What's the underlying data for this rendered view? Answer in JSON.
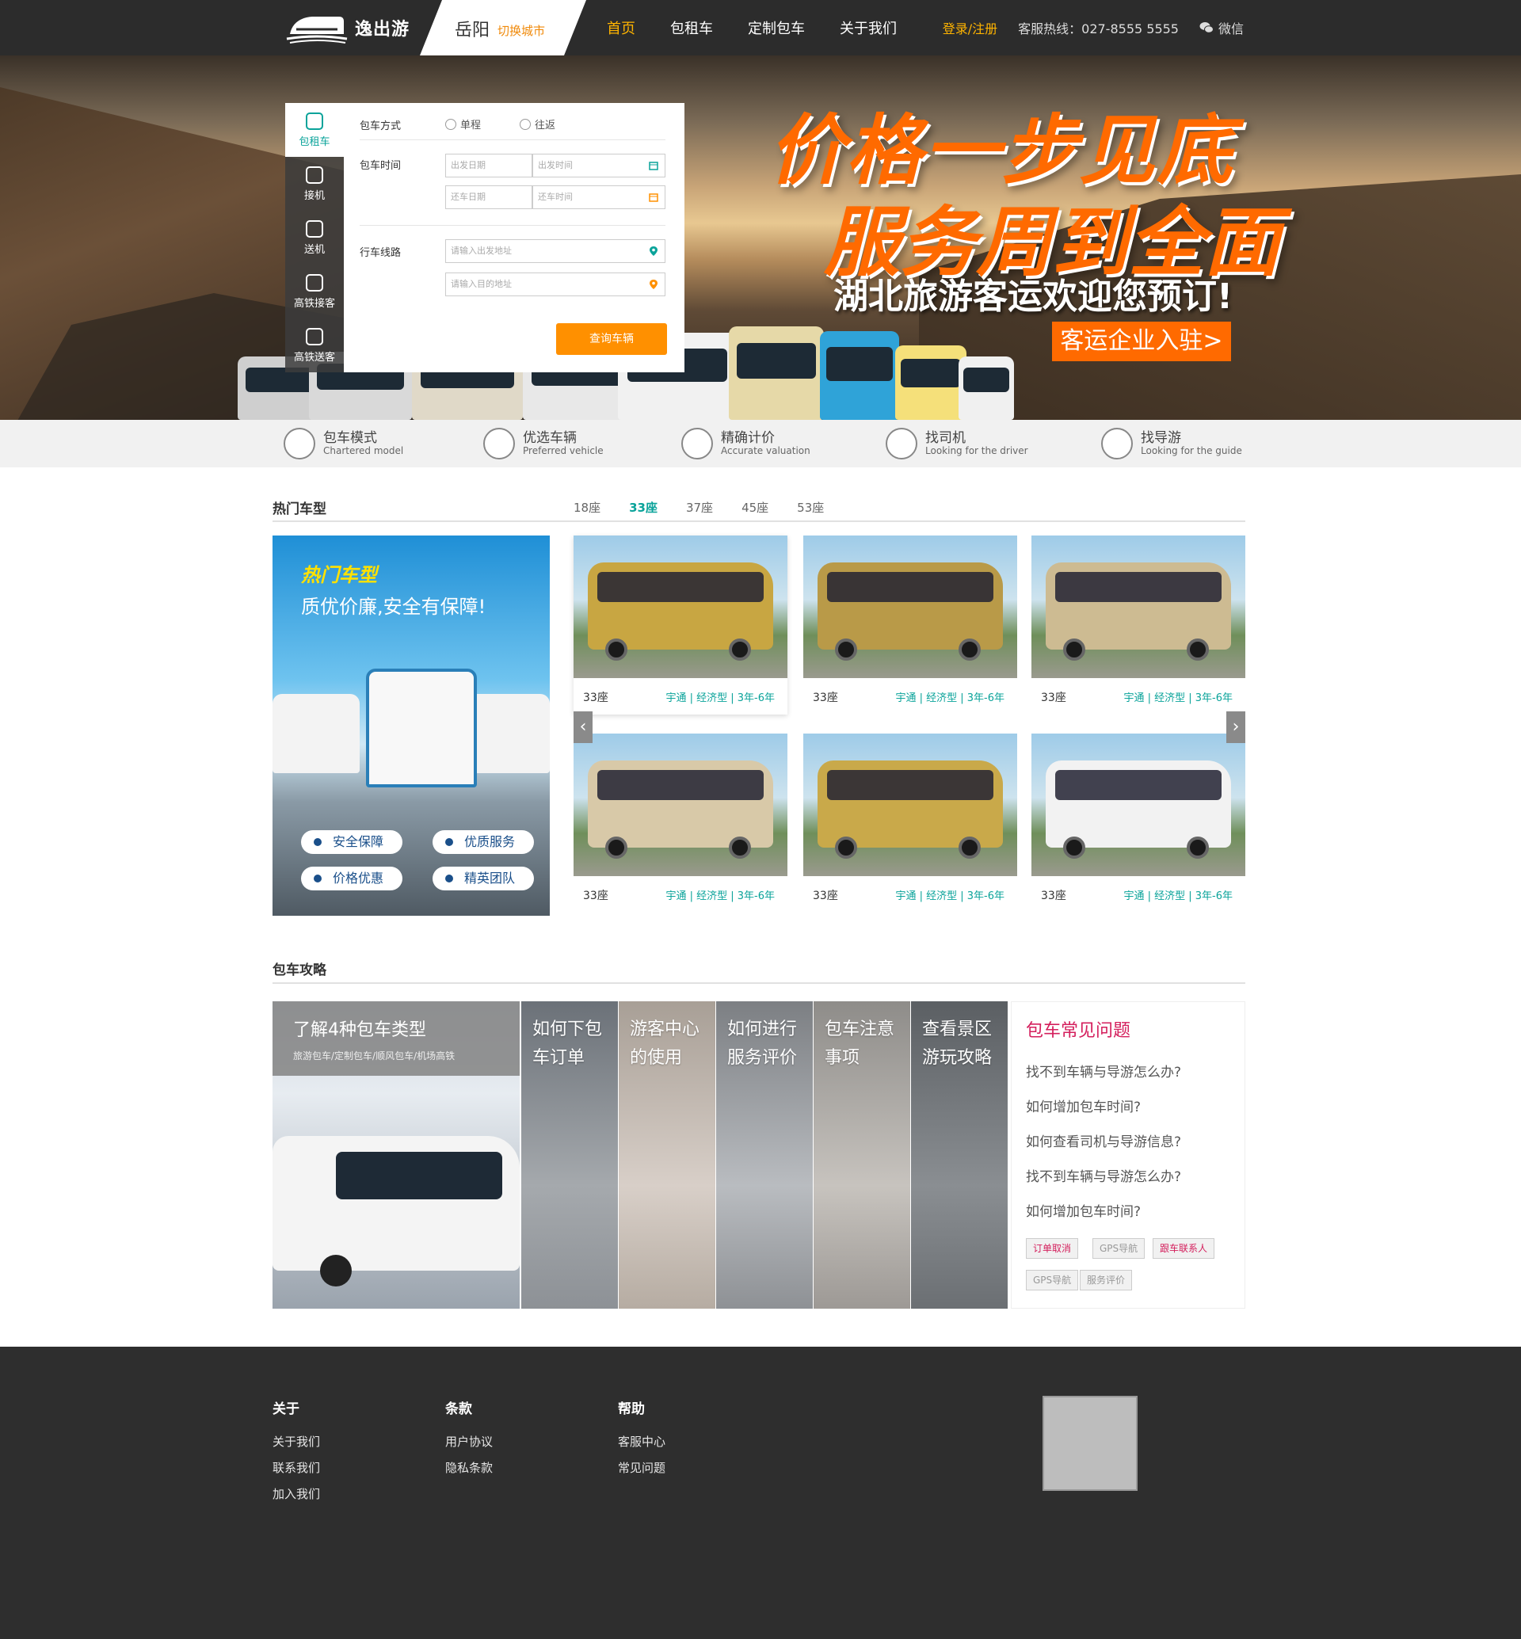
{
  "header": {
    "logo_text": "逸出游",
    "city": "岳阳",
    "city_switch": "切换城市",
    "nav": [
      "首页",
      "包租车",
      "定制包车",
      "关于我们"
    ],
    "login": "登录/注册",
    "hotline": "客服热线：027-8555 5555",
    "wechat": "微信"
  },
  "banner": {
    "slogan1": "价格一步见底",
    "slogan2": "服务周到全面",
    "slogan3": "湖北旅游客运欢迎您预订!",
    "enter_button": "客运企业入驻>"
  },
  "booking": {
    "side_tabs": [
      "包租车",
      "接机",
      "送机",
      "高铁接客",
      "高铁送客"
    ],
    "mode_label": "包车方式",
    "mode_options": [
      "单程",
      "往返"
    ],
    "time_label": "包车时间",
    "depart_date": "出发日期",
    "depart_time": "出发时间",
    "return_date": "还车日期",
    "return_time": "还车时间",
    "route_label": "行车线路",
    "from_placeholder": "请输入出发地址",
    "to_placeholder": "请输入目的地址",
    "query_button": "查询车辆"
  },
  "features": [
    {
      "cn": "包车模式",
      "en": "Chartered model",
      "icon": "bus-icon"
    },
    {
      "cn": "优选车辆",
      "en": "Preferred vehicle",
      "icon": "van-icon"
    },
    {
      "cn": "精确计价",
      "en": "Accurate valuation",
      "icon": "calculator-icon"
    },
    {
      "cn": "找司机",
      "en": "Looking for the driver",
      "icon": "driver-icon"
    },
    {
      "cn": "找导游",
      "en": "Looking for the guide",
      "icon": "guide-icon"
    }
  ],
  "hot": {
    "title": "热门车型",
    "seat_tabs": [
      "18座",
      "33座",
      "37座",
      "45座",
      "53座"
    ],
    "active_tab": "33座",
    "promo_title": "热门车型",
    "promo_subtitle": "质优价廉,安全有保障!",
    "promo_pills": [
      "安全保障",
      "优质服务",
      "价格优惠",
      "精英团队"
    ],
    "cars": [
      {
        "seat": "33座",
        "info": "宇通 | 经济型 | 3年-6年"
      },
      {
        "seat": "33座",
        "info": "宇通 | 经济型 | 3年-6年"
      },
      {
        "seat": "33座",
        "info": "宇通 | 经济型 | 3年-6年"
      },
      {
        "seat": "33座",
        "info": "宇通 | 经济型 | 3年-6年"
      },
      {
        "seat": "33座",
        "info": "宇通 | 经济型 | 3年-6年"
      },
      {
        "seat": "33座",
        "info": "宇通 | 经济型 | 3年-6年"
      }
    ],
    "prev": "‹",
    "next": "›"
  },
  "guide": {
    "title": "包车攻略",
    "big_title": "了解4种包车类型",
    "big_sub": "旅游包车/定制包车/顺风包车/机场高铁",
    "columns": [
      "如何下包车订单",
      "游客中心的使用",
      "如何进行服务评价",
      "包车注意事项",
      "查看景区游玩攻略"
    ],
    "faq_title": "包车常见问题",
    "faq": [
      "找不到车辆与导游怎么办?",
      "如何增加包车时间?",
      "如何查看司机与导游信息?",
      "找不到车辆与导游怎么办?",
      "如何增加包车时间?"
    ],
    "tags": [
      "订单取消",
      "GPS导航",
      "跟车联系人",
      "GPS导航",
      "服务评价"
    ]
  },
  "footer": {
    "cols": [
      {
        "title": "关于",
        "links": [
          "关于我们",
          "联系我们",
          "加入我们"
        ]
      },
      {
        "title": "条款",
        "links": [
          "用户协议",
          "隐私条款"
        ]
      },
      {
        "title": "帮助",
        "links": [
          "客服中心",
          "常见问题"
        ]
      }
    ]
  },
  "colors": {
    "accent": "#ffb400",
    "teal": "#0aa39a",
    "orange": "#ff9000",
    "pink": "#d41e5c",
    "dark": "#2c2c2c"
  }
}
